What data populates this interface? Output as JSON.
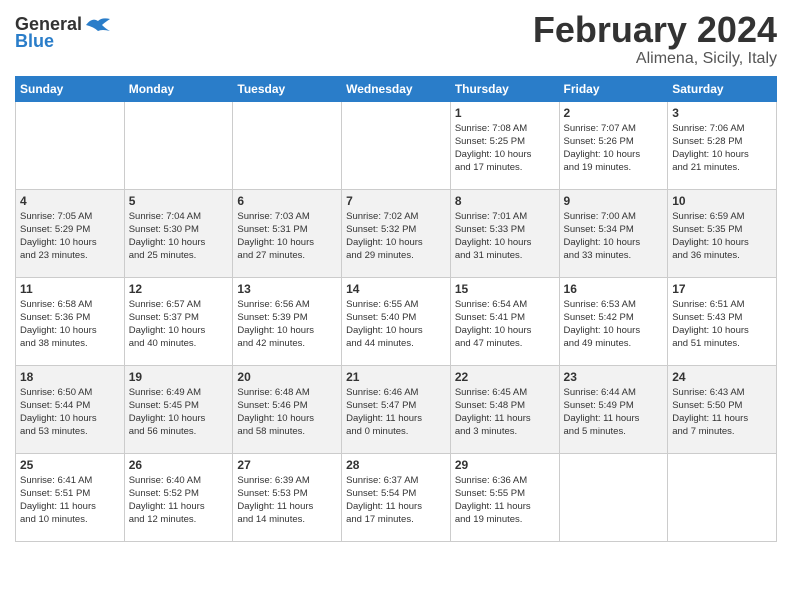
{
  "header": {
    "logo_general": "General",
    "logo_blue": "Blue",
    "month_title": "February 2024",
    "location": "Alimena, Sicily, Italy"
  },
  "days_of_week": [
    "Sunday",
    "Monday",
    "Tuesday",
    "Wednesday",
    "Thursday",
    "Friday",
    "Saturday"
  ],
  "weeks": [
    [
      {
        "day": "",
        "info": ""
      },
      {
        "day": "",
        "info": ""
      },
      {
        "day": "",
        "info": ""
      },
      {
        "day": "",
        "info": ""
      },
      {
        "day": "1",
        "info": "Sunrise: 7:08 AM\nSunset: 5:25 PM\nDaylight: 10 hours\nand 17 minutes."
      },
      {
        "day": "2",
        "info": "Sunrise: 7:07 AM\nSunset: 5:26 PM\nDaylight: 10 hours\nand 19 minutes."
      },
      {
        "day": "3",
        "info": "Sunrise: 7:06 AM\nSunset: 5:28 PM\nDaylight: 10 hours\nand 21 minutes."
      }
    ],
    [
      {
        "day": "4",
        "info": "Sunrise: 7:05 AM\nSunset: 5:29 PM\nDaylight: 10 hours\nand 23 minutes."
      },
      {
        "day": "5",
        "info": "Sunrise: 7:04 AM\nSunset: 5:30 PM\nDaylight: 10 hours\nand 25 minutes."
      },
      {
        "day": "6",
        "info": "Sunrise: 7:03 AM\nSunset: 5:31 PM\nDaylight: 10 hours\nand 27 minutes."
      },
      {
        "day": "7",
        "info": "Sunrise: 7:02 AM\nSunset: 5:32 PM\nDaylight: 10 hours\nand 29 minutes."
      },
      {
        "day": "8",
        "info": "Sunrise: 7:01 AM\nSunset: 5:33 PM\nDaylight: 10 hours\nand 31 minutes."
      },
      {
        "day": "9",
        "info": "Sunrise: 7:00 AM\nSunset: 5:34 PM\nDaylight: 10 hours\nand 33 minutes."
      },
      {
        "day": "10",
        "info": "Sunrise: 6:59 AM\nSunset: 5:35 PM\nDaylight: 10 hours\nand 36 minutes."
      }
    ],
    [
      {
        "day": "11",
        "info": "Sunrise: 6:58 AM\nSunset: 5:36 PM\nDaylight: 10 hours\nand 38 minutes."
      },
      {
        "day": "12",
        "info": "Sunrise: 6:57 AM\nSunset: 5:37 PM\nDaylight: 10 hours\nand 40 minutes."
      },
      {
        "day": "13",
        "info": "Sunrise: 6:56 AM\nSunset: 5:39 PM\nDaylight: 10 hours\nand 42 minutes."
      },
      {
        "day": "14",
        "info": "Sunrise: 6:55 AM\nSunset: 5:40 PM\nDaylight: 10 hours\nand 44 minutes."
      },
      {
        "day": "15",
        "info": "Sunrise: 6:54 AM\nSunset: 5:41 PM\nDaylight: 10 hours\nand 47 minutes."
      },
      {
        "day": "16",
        "info": "Sunrise: 6:53 AM\nSunset: 5:42 PM\nDaylight: 10 hours\nand 49 minutes."
      },
      {
        "day": "17",
        "info": "Sunrise: 6:51 AM\nSunset: 5:43 PM\nDaylight: 10 hours\nand 51 minutes."
      }
    ],
    [
      {
        "day": "18",
        "info": "Sunrise: 6:50 AM\nSunset: 5:44 PM\nDaylight: 10 hours\nand 53 minutes."
      },
      {
        "day": "19",
        "info": "Sunrise: 6:49 AM\nSunset: 5:45 PM\nDaylight: 10 hours\nand 56 minutes."
      },
      {
        "day": "20",
        "info": "Sunrise: 6:48 AM\nSunset: 5:46 PM\nDaylight: 10 hours\nand 58 minutes."
      },
      {
        "day": "21",
        "info": "Sunrise: 6:46 AM\nSunset: 5:47 PM\nDaylight: 11 hours\nand 0 minutes."
      },
      {
        "day": "22",
        "info": "Sunrise: 6:45 AM\nSunset: 5:48 PM\nDaylight: 11 hours\nand 3 minutes."
      },
      {
        "day": "23",
        "info": "Sunrise: 6:44 AM\nSunset: 5:49 PM\nDaylight: 11 hours\nand 5 minutes."
      },
      {
        "day": "24",
        "info": "Sunrise: 6:43 AM\nSunset: 5:50 PM\nDaylight: 11 hours\nand 7 minutes."
      }
    ],
    [
      {
        "day": "25",
        "info": "Sunrise: 6:41 AM\nSunset: 5:51 PM\nDaylight: 11 hours\nand 10 minutes."
      },
      {
        "day": "26",
        "info": "Sunrise: 6:40 AM\nSunset: 5:52 PM\nDaylight: 11 hours\nand 12 minutes."
      },
      {
        "day": "27",
        "info": "Sunrise: 6:39 AM\nSunset: 5:53 PM\nDaylight: 11 hours\nand 14 minutes."
      },
      {
        "day": "28",
        "info": "Sunrise: 6:37 AM\nSunset: 5:54 PM\nDaylight: 11 hours\nand 17 minutes."
      },
      {
        "day": "29",
        "info": "Sunrise: 6:36 AM\nSunset: 5:55 PM\nDaylight: 11 hours\nand 19 minutes."
      },
      {
        "day": "",
        "info": ""
      },
      {
        "day": "",
        "info": ""
      }
    ]
  ]
}
